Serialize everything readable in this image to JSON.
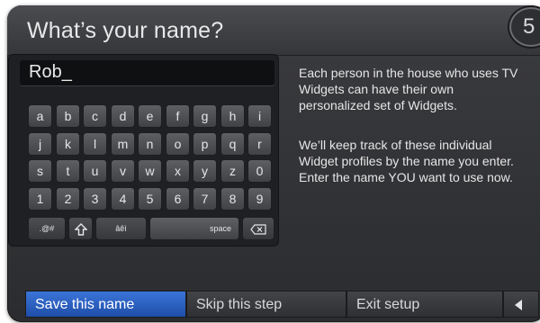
{
  "header": {
    "title": "What’s your name?",
    "badge": "5"
  },
  "name_input": {
    "value": "Rob_"
  },
  "keyboard": {
    "row1": [
      "a",
      "b",
      "c",
      "d",
      "e",
      "f",
      "g",
      "h",
      "i"
    ],
    "row2": [
      "j",
      "k",
      "l",
      "m",
      "n",
      "o",
      "p",
      "q",
      "r"
    ],
    "row3": [
      "s",
      "t",
      "u",
      "v",
      "w",
      "x",
      "y",
      "z",
      "0"
    ],
    "row4": [
      "1",
      "2",
      "3",
      "4",
      "5",
      "6",
      "7",
      "8",
      "9"
    ],
    "symbols_label": ".@#",
    "accents_label": "âêì",
    "space_label": "space",
    "shift_icon": "shift-arrow-icon",
    "backspace_icon": "backspace-icon"
  },
  "description": {
    "paragraph1": "Each person in the house who uses TV Widgets can have their own personalized set of Widgets.",
    "paragraph2": "We’ll keep track of these individual Widget profiles by the name you enter. Enter the name YOU want to use now."
  },
  "footer": {
    "save_label": "Save this name",
    "skip_label": "Skip this step",
    "exit_label": "Exit setup",
    "arrow_icon": "left-arrow-icon"
  },
  "colors": {
    "accent": "#2a62c8",
    "panel": "#323336",
    "text": "#e6e6e6"
  }
}
